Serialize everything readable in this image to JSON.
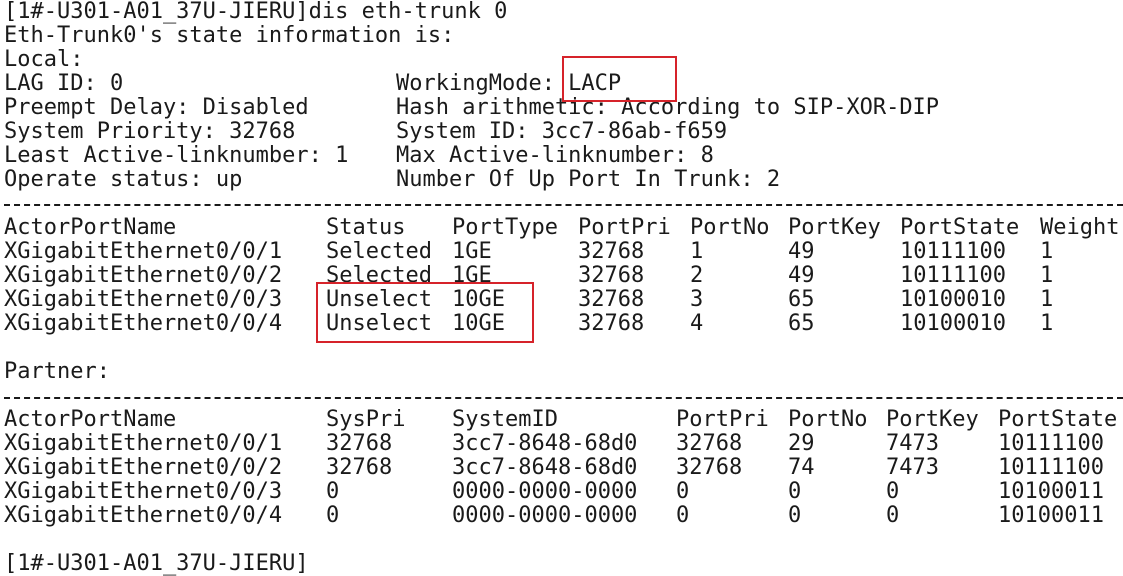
{
  "terminal": {
    "prompt_line": "[1#-U301-A01_37U-JIERU]dis eth-trunk 0",
    "state_header": "Eth-Trunk0's state information is:",
    "local_label": "Local:",
    "local_info": [
      {
        "left": "LAG ID: 0",
        "right": "WorkingMode: LACP"
      },
      {
        "left": "Preempt Delay: Disabled",
        "right": "Hash arithmetic: According to SIP-XOR-DIP"
      },
      {
        "left": "System Priority: 32768",
        "right": "System ID: 3cc7-86ab-f659"
      },
      {
        "left": "Least Active-linknumber: 1",
        "right": "Max Active-linknumber: 8"
      },
      {
        "left": "Operate status: up",
        "right": "Number Of Up Port In Trunk: 2"
      }
    ],
    "actor_table": {
      "headers": [
        "ActorPortName",
        "Status",
        "PortType",
        "PortPri",
        "PortNo",
        "PortKey",
        "PortState",
        "Weight"
      ],
      "rows": [
        [
          "XGigabitEthernet0/0/1",
          "Selected",
          "1GE",
          "32768",
          "1",
          "49",
          "10111100",
          "1"
        ],
        [
          "XGigabitEthernet0/0/2",
          "Selected",
          "1GE",
          "32768",
          "2",
          "49",
          "10111100",
          "1"
        ],
        [
          "XGigabitEthernet0/0/3",
          "Unselect",
          "10GE",
          "32768",
          "3",
          "65",
          "10100010",
          "1"
        ],
        [
          "XGigabitEthernet0/0/4",
          "Unselect",
          "10GE",
          "32768",
          "4",
          "65",
          "10100010",
          "1"
        ]
      ]
    },
    "partner_label": "Partner:",
    "partner_table": {
      "headers": [
        "ActorPortName",
        "SysPri",
        "SystemID",
        "PortPri",
        "PortNo",
        "PortKey",
        "PortState"
      ],
      "rows": [
        [
          "XGigabitEthernet0/0/1",
          "32768",
          "3cc7-8648-68d0",
          "32768",
          "29",
          "7473",
          "10111100"
        ],
        [
          "XGigabitEthernet0/0/2",
          "32768",
          "3cc7-8648-68d0",
          "32768",
          "74",
          "7473",
          "10111100"
        ],
        [
          "XGigabitEthernet0/0/3",
          "0",
          "0000-0000-0000",
          "0",
          "0",
          "0",
          "10100011"
        ],
        [
          "XGigabitEthernet0/0/4",
          "0",
          "0000-0000-0000",
          "0",
          "0",
          "0",
          "10100011"
        ]
      ]
    },
    "final_prompt": "[1#-U301-A01_37U-JIERU]"
  },
  "colors": {
    "text": "#1a1a1a",
    "background": "#ffffff",
    "highlight_box": "#d6232a"
  }
}
